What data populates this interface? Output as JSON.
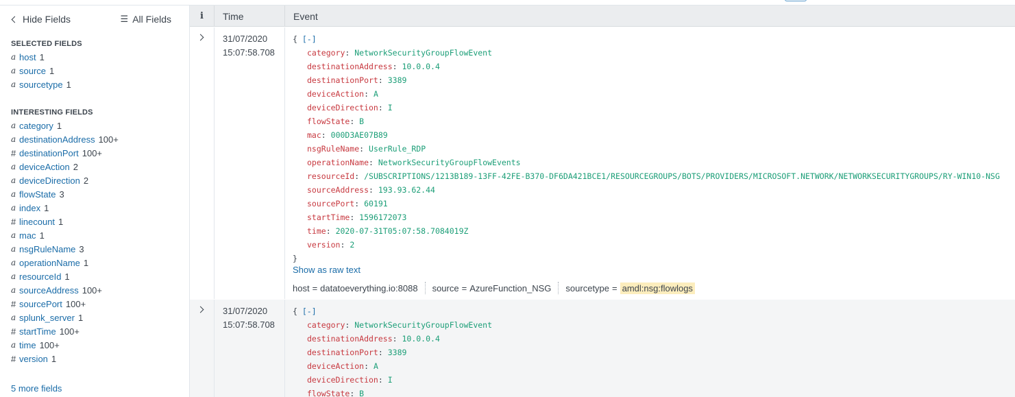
{
  "sidebar": {
    "hide_fields": "Hide Fields",
    "all_fields": "All Fields",
    "selected_title": "SELECTED FIELDS",
    "selected": [
      {
        "type": "a",
        "name": "host",
        "count": "1"
      },
      {
        "type": "a",
        "name": "source",
        "count": "1"
      },
      {
        "type": "a",
        "name": "sourcetype",
        "count": "1"
      }
    ],
    "interesting_title": "INTERESTING FIELDS",
    "interesting": [
      {
        "type": "a",
        "name": "category",
        "count": "1"
      },
      {
        "type": "a",
        "name": "destinationAddress",
        "count": "100+"
      },
      {
        "type": "#",
        "name": "destinationPort",
        "count": "100+"
      },
      {
        "type": "a",
        "name": "deviceAction",
        "count": "2"
      },
      {
        "type": "a",
        "name": "deviceDirection",
        "count": "2"
      },
      {
        "type": "a",
        "name": "flowState",
        "count": "3"
      },
      {
        "type": "a",
        "name": "index",
        "count": "1"
      },
      {
        "type": "#",
        "name": "linecount",
        "count": "1"
      },
      {
        "type": "a",
        "name": "mac",
        "count": "1"
      },
      {
        "type": "a",
        "name": "nsgRuleName",
        "count": "3"
      },
      {
        "type": "a",
        "name": "operationName",
        "count": "1"
      },
      {
        "type": "a",
        "name": "resourceId",
        "count": "1"
      },
      {
        "type": "a",
        "name": "sourceAddress",
        "count": "100+"
      },
      {
        "type": "#",
        "name": "sourcePort",
        "count": "100+"
      },
      {
        "type": "a",
        "name": "splunk_server",
        "count": "1"
      },
      {
        "type": "#",
        "name": "startTime",
        "count": "100+"
      },
      {
        "type": "a",
        "name": "time",
        "count": "100+"
      },
      {
        "type": "#",
        "name": "version",
        "count": "1"
      }
    ],
    "more_fields": "5 more fields"
  },
  "table": {
    "col_info": "i",
    "col_time": "Time",
    "col_event": "Event"
  },
  "events": [
    {
      "date": "31/07/2020",
      "time": "15:07:58.708",
      "open_brace": "{",
      "collapse": "[-]",
      "close_brace": "}",
      "fields": [
        {
          "k": "category",
          "v": "NetworkSecurityGroupFlowEvent"
        },
        {
          "k": "destinationAddress",
          "v": "10.0.0.4"
        },
        {
          "k": "destinationPort",
          "v": "3389"
        },
        {
          "k": "deviceAction",
          "v": "A"
        },
        {
          "k": "deviceDirection",
          "v": "I"
        },
        {
          "k": "flowState",
          "v": "B"
        },
        {
          "k": "mac",
          "v": "000D3AE07B89"
        },
        {
          "k": "nsgRuleName",
          "v": "UserRule_RDP"
        },
        {
          "k": "operationName",
          "v": "NetworkSecurityGroupFlowEvents"
        },
        {
          "k": "resourceId",
          "v": "/SUBSCRIPTIONS/1213B189-13FF-42FE-B370-DF6DA421BCE1/RESOURCEGROUPS/BOTS/PROVIDERS/MICROSOFT.NETWORK/NETWORKSECURITYGROUPS/RY-WIN10-NSG"
        },
        {
          "k": "sourceAddress",
          "v": "193.93.62.44"
        },
        {
          "k": "sourcePort",
          "v": "60191"
        },
        {
          "k": "startTime",
          "v": "1596172073"
        },
        {
          "k": "time",
          "v": "2020-07-31T05:07:58.7084019Z"
        },
        {
          "k": "version",
          "v": "2"
        }
      ],
      "show_raw": "Show as raw text",
      "meta": {
        "host_label": "host",
        "host_value": "datatoeverything.io:8088",
        "source_label": "source",
        "source_value": "AzureFunction_NSG",
        "sourcetype_label": "sourcetype",
        "sourcetype_value": "amdl:nsg:flowlogs"
      }
    },
    {
      "date": "31/07/2020",
      "time": "15:07:58.708",
      "open_brace": "{",
      "collapse": "[-]",
      "fields": [
        {
          "k": "category",
          "v": "NetworkSecurityGroupFlowEvent"
        },
        {
          "k": "destinationAddress",
          "v": "10.0.0.4"
        },
        {
          "k": "destinationPort",
          "v": "3389"
        },
        {
          "k": "deviceAction",
          "v": "A"
        },
        {
          "k": "deviceDirection",
          "v": "I"
        },
        {
          "k": "flowState",
          "v": "B"
        }
      ]
    }
  ],
  "icons": {
    "hide": "chevron-left-icon",
    "all": "list-icon",
    "expand": "chevron-right-icon"
  }
}
